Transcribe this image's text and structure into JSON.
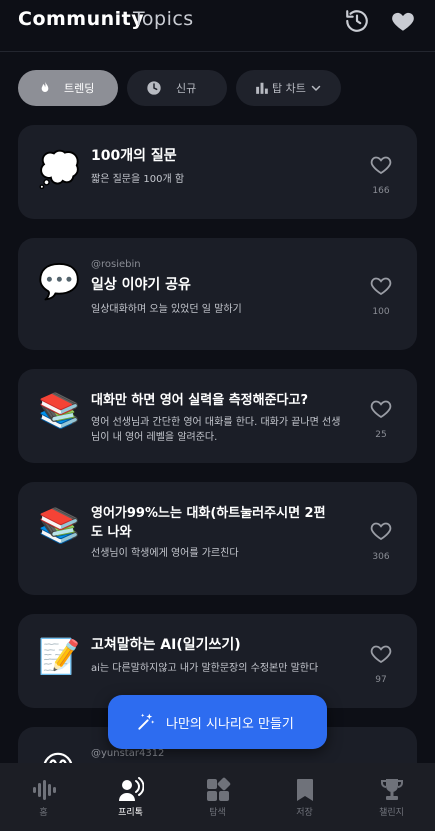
{
  "header": {
    "tabs": [
      "Community",
      "Topics"
    ],
    "icons": [
      "history-icon",
      "heart-icon"
    ]
  },
  "filters": [
    {
      "label": "트렌딩",
      "icon": "flame-icon",
      "active": true
    },
    {
      "label": "신규",
      "icon": "clock-icon",
      "active": false
    },
    {
      "label": "탑 차트",
      "icon": "bar-chart-icon",
      "active": false
    }
  ],
  "cards": [
    {
      "emoji": "💭",
      "author": "",
      "title": "100개의 질문",
      "desc": "짧은 질문을 100개 함",
      "likes": "166"
    },
    {
      "emoji": "💬",
      "author": "@rosiebin",
      "title": "일상 이야기 공유",
      "desc": "일상대화하며 오늘 있었던 일 말하기",
      "likes": "100"
    },
    {
      "emoji": "📚",
      "author": "",
      "title": "대화만 하면 영어 실력을 측정해준다고?",
      "desc": "영어 선생님과 간단한 영어 대화를 한다. 대화가 끝나면 선생님이 내 영어 레벨을 알려준다.",
      "likes": "25"
    },
    {
      "emoji": "📚",
      "author": "",
      "title": "영어가99%느는 대화(하트눌러주시면 2편도 나와",
      "desc": "선생님이 학생에게 영어를 가르친다",
      "likes": "306"
    },
    {
      "emoji": "📝",
      "author": "",
      "title": "고쳐말하는 AI(일기쓰기)",
      "desc": "ai는 다른말하지않고 내가 말한문장의 수정본만 말한다",
      "likes": "97"
    },
    {
      "emoji": "😊",
      "author": "@yunstar4312",
      "title": "",
      "desc": "",
      "likes": ""
    }
  ],
  "fab": {
    "label": "나만의 시나리오 만들기",
    "icon": "magic-wand-icon"
  },
  "bottom_nav": [
    {
      "label": "홈",
      "icon": "soundwave-icon",
      "active": false
    },
    {
      "label": "프리톡",
      "icon": "people-talk-icon",
      "active": true
    },
    {
      "label": "탐색",
      "icon": "grid-icon",
      "active": false
    },
    {
      "label": "저장",
      "icon": "bookmark-icon",
      "active": false
    },
    {
      "label": "챌린지",
      "icon": "trophy-icon",
      "active": false
    }
  ],
  "colors": {
    "background": "#0d0f16",
    "card": "#1b1e27",
    "accent": "#2d6cf0",
    "chip_active": "#8d8f96"
  }
}
